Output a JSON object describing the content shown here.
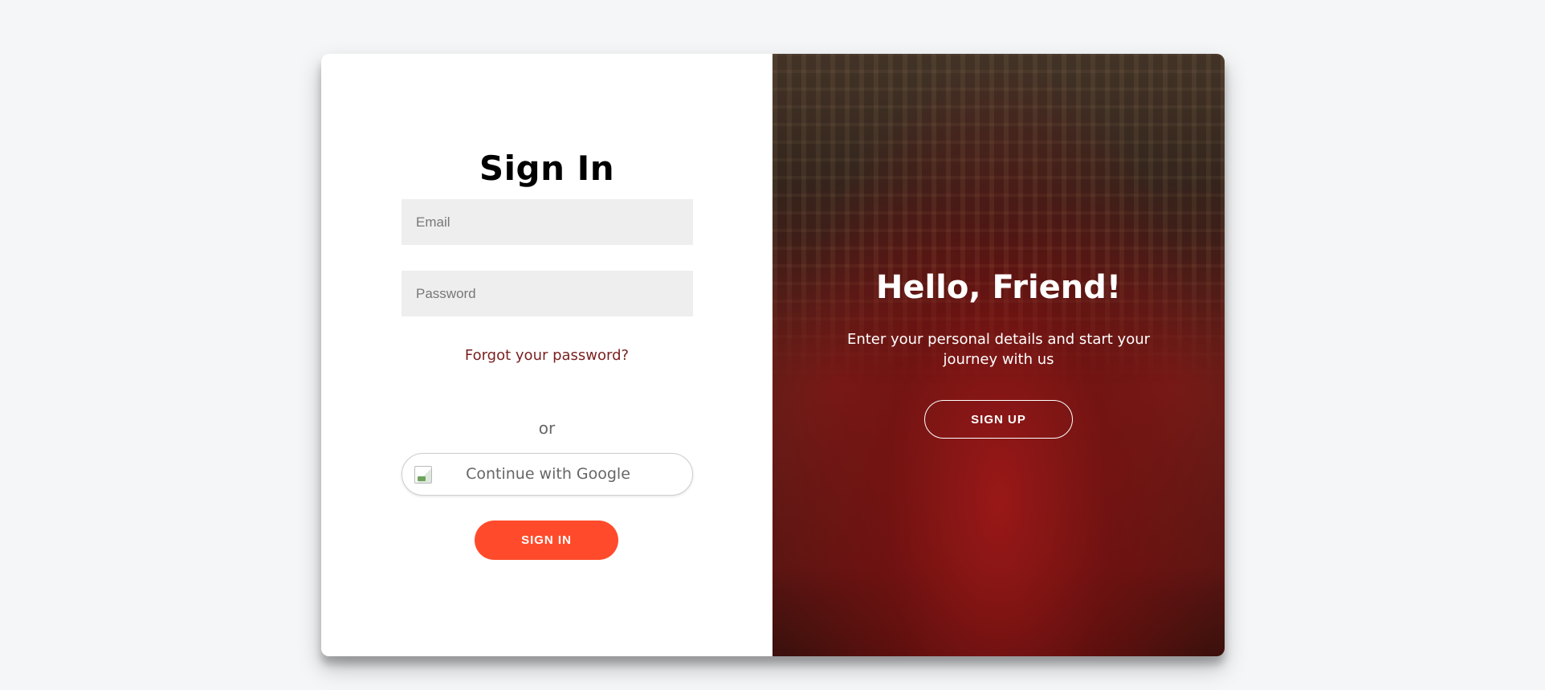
{
  "signin": {
    "title": "Sign In",
    "email_placeholder": "Email",
    "password_placeholder": "Password",
    "forgot_link": "Forgot your password?",
    "or_divider": "or",
    "google_button": "Continue with Google",
    "google_icon": "broken-image-icon",
    "submit_button": "SIGN IN"
  },
  "overlay": {
    "heading": "Hello, Friend!",
    "text": "Enter your personal details and start your journey with us",
    "signup_button": "SIGN UP"
  },
  "colors": {
    "accent": "#ff4b2b",
    "link": "#7a1f1f",
    "page_background": "#f5f6f8",
    "input_background": "#eeeeee"
  }
}
